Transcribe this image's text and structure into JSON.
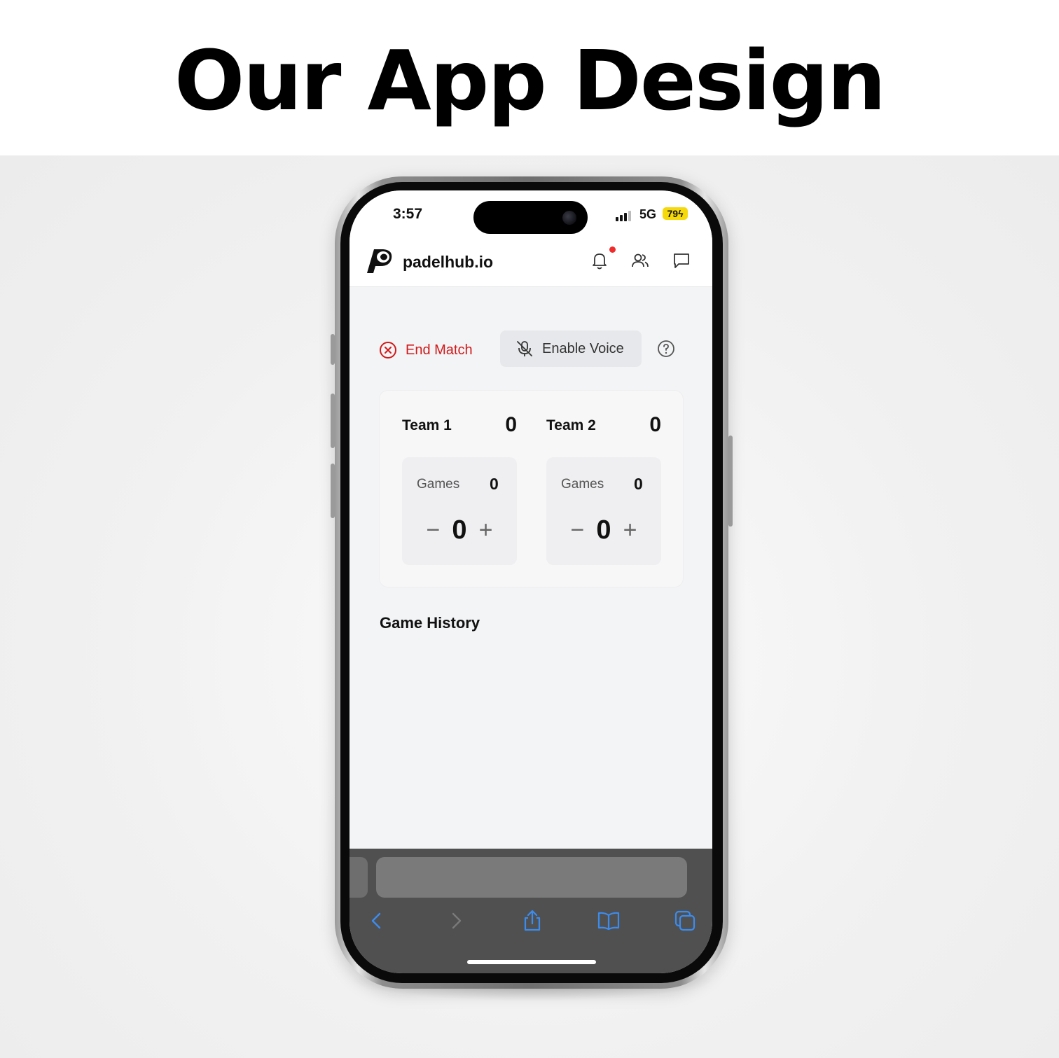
{
  "headline": "Our App Design",
  "statusbar": {
    "time": "3:57",
    "network": "5G",
    "battery": "79"
  },
  "app": {
    "brand": "padelhub.io",
    "nav_icons": [
      "bell-icon",
      "users-icon",
      "chat-icon"
    ],
    "notification_dot_color": "#ef2b2b"
  },
  "actions": {
    "end_match": "End Match",
    "enable_voice": "Enable Voice",
    "end_match_color": "#d11a1a"
  },
  "teams": [
    {
      "name": "Team 1",
      "score": "0",
      "games_label": "Games",
      "games": "0",
      "points": "0",
      "minus": "−",
      "plus": "+"
    },
    {
      "name": "Team 2",
      "score": "0",
      "games_label": "Games",
      "games": "0",
      "points": "0",
      "minus": "−",
      "plus": "+"
    }
  ],
  "history": {
    "title": "Game History"
  },
  "browser": {
    "toolbar_icons": [
      "back-icon",
      "forward-icon",
      "share-icon",
      "bookmarks-icon",
      "tabs-icon"
    ],
    "accent": "#3b8cf0"
  }
}
